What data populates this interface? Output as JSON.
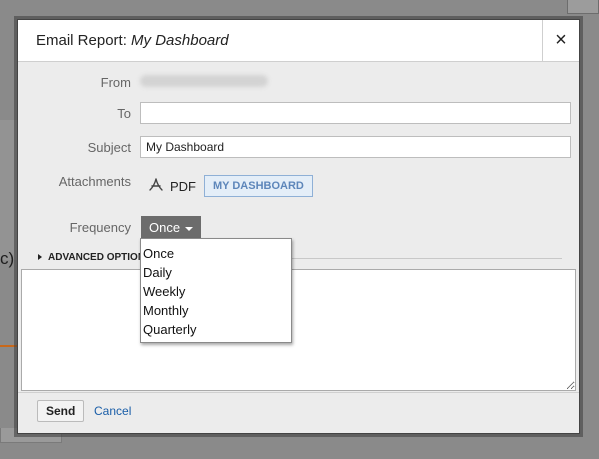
{
  "background": {
    "left_text": "c)"
  },
  "dialog": {
    "title_prefix": "Email Report: ",
    "title_name": "My Dashboard",
    "close_label": "×"
  },
  "form": {
    "from_label": "From",
    "to_label": "To",
    "to_value": "",
    "subject_label": "Subject",
    "subject_value": "My Dashboard",
    "attachments_label": "Attachments",
    "pdf_label": "PDF",
    "attachment_chip": "MY DASHBOARD",
    "frequency_label": "Frequency",
    "frequency_value": "Once",
    "advanced_options": "ADVANCED OPTIONS"
  },
  "frequency_options": [
    "Once",
    "Daily",
    "Weekly",
    "Monthly",
    "Quarterly"
  ],
  "footer": {
    "send_label": "Send",
    "cancel_label": "Cancel"
  },
  "icons": {
    "close": "close-icon",
    "pdf": "pdf-icon",
    "caret": "chevron-down-icon",
    "advanced": "triangle-right-icon"
  },
  "colors": {
    "chip_text": "#5d86ba",
    "chip_bg": "#e4eef8",
    "select_bg": "#6c6c6c",
    "link": "#1a5ea8"
  }
}
